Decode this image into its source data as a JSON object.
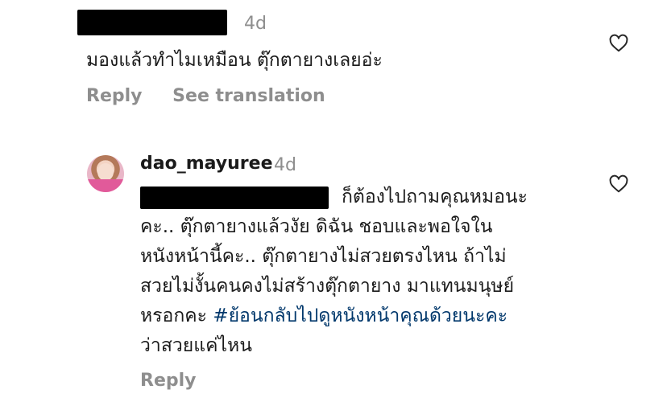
{
  "comment1": {
    "time": "4d",
    "text": "มองแล้วทำไมเหมือน ตุ๊กตายางเลยอ่ะ",
    "actions": {
      "reply": "Reply",
      "translate": "See translation"
    }
  },
  "reply1": {
    "username": "dao_mayuree",
    "time": "4d",
    "lines": [
      "ก็ต้องไปถามคุณหมอนะ",
      "คะ.. ตุ๊กตายางแล้วงัย ดิฉัน ชอบและพอใจใน",
      "หนังหน้านี้คะ.. ตุ๊กตายางไม่สวยตรงไหน ถ้าไม่",
      "สวยไม่งั้นคนคงไม่สร้างตุ๊กตายาง มาแทนมนุษย์",
      "หรอกคะ ",
      "ว่าสวยแค่ไหน"
    ],
    "hashtag": "#ย้อนกลับไปดูหนังหน้าคุณด้วยนะคะ",
    "actions": {
      "reply": "Reply"
    }
  },
  "colors": {
    "hashtag": "#00376b",
    "muted": "#8e8e8e",
    "redaction": "#000000"
  },
  "icons": {
    "like": "heart-outline-icon"
  }
}
